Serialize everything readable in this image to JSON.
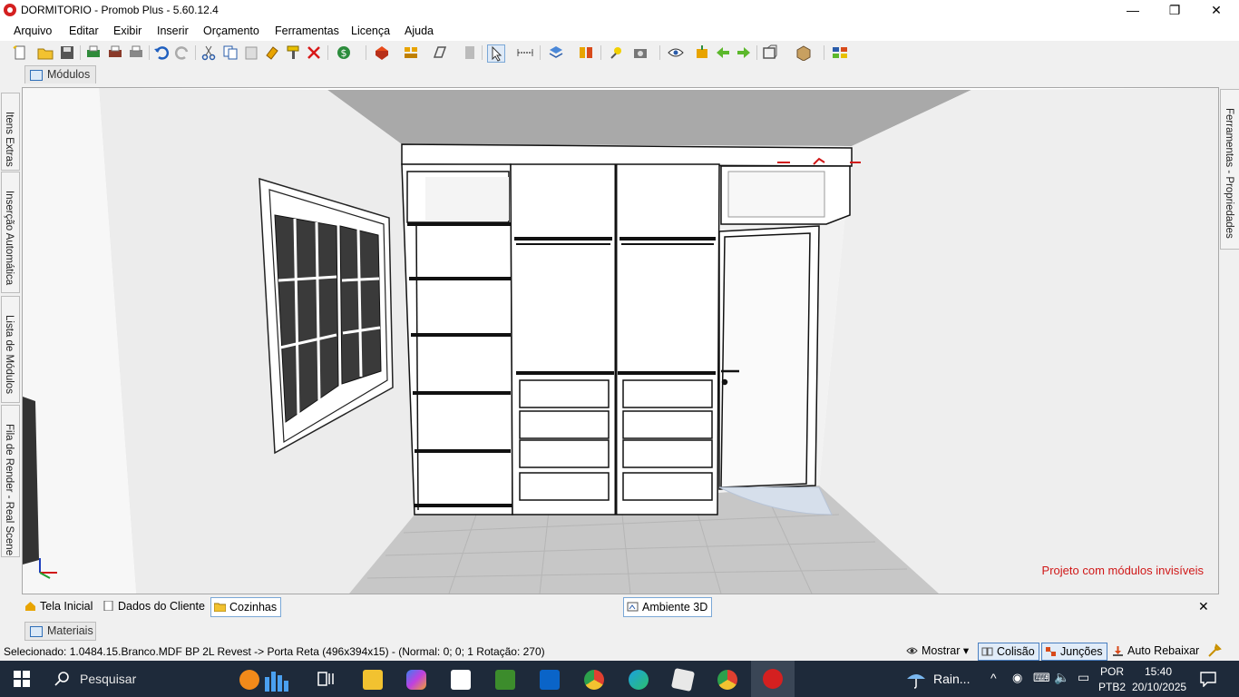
{
  "window": {
    "title": "DORMITORIO - Promob Plus - 5.60.12.4",
    "minimize_glyph": "—",
    "maximize_glyph": "❐",
    "close_glyph": "✕"
  },
  "menu": [
    "Arquivo",
    "Editar",
    "Exibir",
    "Inserir",
    "Orçamento",
    "Ferramentas",
    "Licença",
    "Ajuda"
  ],
  "toolbar": {
    "icons": [
      "new-icon",
      "open-icon",
      "save-icon",
      "print-icon",
      "print-preview-icon",
      "printer-icon",
      "undo-icon",
      "redo-icon",
      "cut-icon",
      "copy-icon",
      "paste-icon",
      "paint-icon",
      "brush-icon",
      "delete-icon",
      "budget-icon",
      "render-icon",
      "modules-icon",
      "shape-icon",
      "wall-icon",
      "select-icon",
      "measure-icon",
      "layers-icon",
      "mirror-icon",
      "light-icon",
      "camera-icon",
      "eye-icon",
      "explode-icon",
      "arrow-left-icon",
      "arrow-right-icon",
      "view-icon",
      "box-icon",
      "colors-icon"
    ]
  },
  "top_tab": {
    "label": "Módulos"
  },
  "left_panel": {
    "tabs": [
      "Itens Extras",
      "Inserção Automática",
      "Lista de Módulos",
      "Fila de Render - Real Scene"
    ]
  },
  "right_panel": {
    "tabs": [
      "Ferramentas - Propriedades"
    ]
  },
  "viewport": {
    "info_text": "Projeto com módulos invisíveis"
  },
  "bottom_tabs": {
    "items": [
      "Tela Inicial",
      "Dados do Cliente",
      "Cozinhas"
    ],
    "active": "Cozinhas",
    "environment_tab": "Ambiente 3D",
    "close_glyph": "✕"
  },
  "materials_tab": {
    "label": "Materiais"
  },
  "status": {
    "selected": "Selecionado: 1.0484.15.Branco.MDF BP 2L Revest -> Porta Reta (496x394x15) - (Normal: 0; 0; 1 Rotação: 270)",
    "show_label": "Mostrar",
    "collision_label": "Colisão",
    "junctions_label": "Junções",
    "auto_lower_label": "Auto Rebaixar"
  },
  "taskbar": {
    "search_placeholder": "Pesquisar",
    "weather": "Rain...",
    "language": "POR",
    "layout": "PTB2",
    "time": "15:40",
    "date": "20/10/2025"
  }
}
